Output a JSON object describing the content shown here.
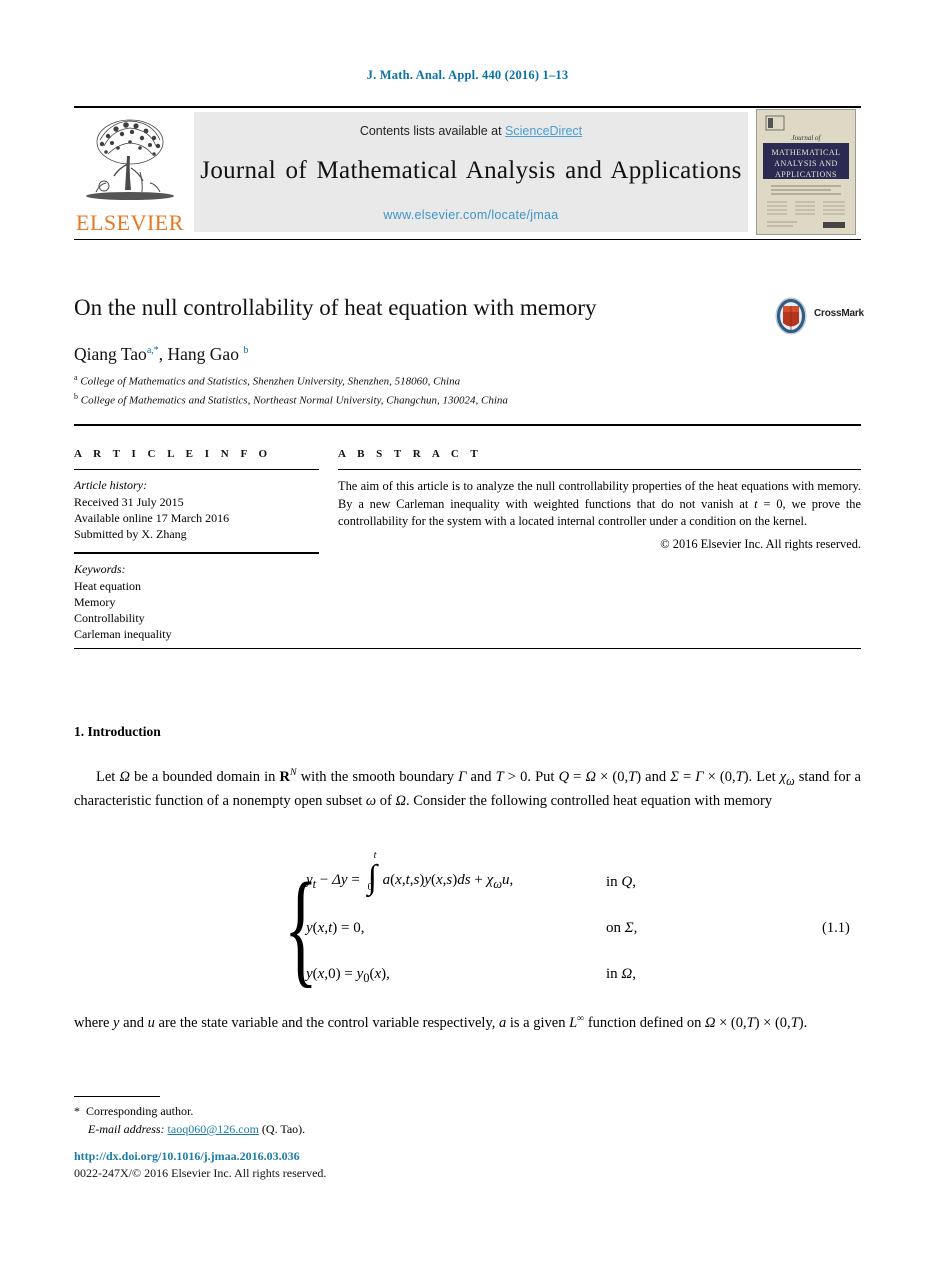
{
  "running_head": "J. Math. Anal. Appl. 440 (2016) 1–13",
  "masthead": {
    "contents_prefix": "Contents lists available at ",
    "sciencedirect": "ScienceDirect",
    "journal_title": "Journal of Mathematical Analysis and Applications",
    "journal_url": "www.elsevier.com/locate/jmaa",
    "publisher": "ELSEVIER",
    "cover": {
      "line_journal_of": "Journal of",
      "line_1": "MATHEMATICAL",
      "line_2": "ANALYSIS AND",
      "line_3": "APPLICATIONS"
    },
    "colors": {
      "link_blue": "#4a9fd4",
      "url_blue": "#3f94c9",
      "elsevier_orange": "#E87722",
      "cover_band": "#2b2a52",
      "cover_bg": "#ded9c4"
    }
  },
  "article": {
    "title": "On the null controllability of heat equation with memory",
    "crossmark_label": "CrossMark",
    "authors": [
      {
        "name": "Qiang Tao",
        "marks": "a,*"
      },
      {
        "name": "Hang Gao",
        "marks": "b"
      }
    ],
    "affiliations": [
      {
        "mark": "a",
        "text": "College of Mathematics and Statistics, Shenzhen University, Shenzhen, 518060, China"
      },
      {
        "mark": "b",
        "text": "College of Mathematics and Statistics, Northeast Normal University, Changchun, 130024, China"
      }
    ]
  },
  "info": {
    "heading": "A R T I C L E   I N F O",
    "history_label": "Article history:",
    "history": [
      "Received 31 July 2015",
      "Available online 17 March 2016",
      "Submitted by X. Zhang"
    ],
    "keywords_label": "Keywords:",
    "keywords": [
      "Heat equation",
      "Memory",
      "Controllability",
      "Carleman inequality"
    ]
  },
  "abstract": {
    "heading": "A B S T R A C T",
    "text": "The aim of this article is to analyze the null controllability properties of the heat equations with memory. By a new Carleman inequality with weighted functions that do not vanish at t = 0, we prove the controllability for the system with a located internal controller under a condition on the kernel.",
    "copyright": "© 2016 Elsevier Inc. All rights reserved."
  },
  "body": {
    "section_title": "1. Introduction",
    "paragraph_1": "Let Ω be a bounded domain in R^N with the smooth boundary Γ and T > 0. Put Q = Ω × (0,T) and Σ = Γ × (0,T). Let χ_ω stand for a characteristic function of a nonempty open subset ω of Ω. Consider the following controlled heat equation with memory",
    "paragraph_2": "where y and u are the state variable and the control variable respectively, a is a given L^∞ function defined on Ω × (0,T) × (0,T)."
  },
  "equation": {
    "number": "(1.1)",
    "integral_lower": "0",
    "integral_upper": "t",
    "rows": [
      {
        "lhs_pre": "y",
        "lhs": "y_t − Δy = ∫ a(x,t,s)y(x,s)ds + χ_ω u,",
        "where": "in Q,"
      },
      {
        "lhs": "y(x,t) = 0,",
        "where": "on Σ,"
      },
      {
        "lhs": "y(x,0) = y_0(x),",
        "where": "in Ω,"
      }
    ]
  },
  "footnote": {
    "star": "*",
    "corresponding": "Corresponding author.",
    "email_label": "E-mail address:",
    "email": "taoq060@126.com",
    "email_suffix": "(Q. Tao)."
  },
  "footer": {
    "doi": "http://dx.doi.org/10.1016/j.jmaa.2016.03.036",
    "issn_line": "0022-247X/© 2016 Elsevier Inc. All rights reserved."
  }
}
